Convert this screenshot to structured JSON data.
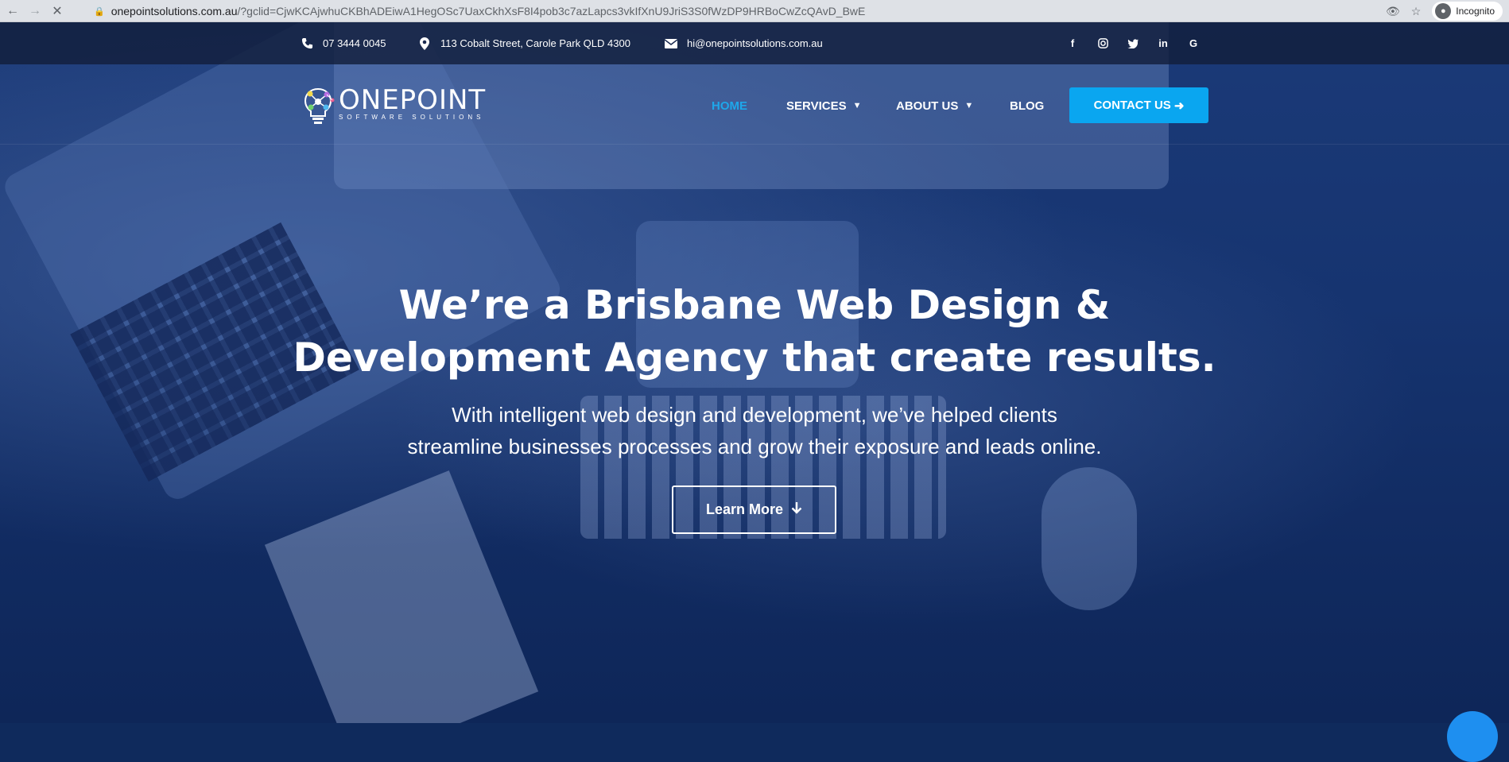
{
  "browser": {
    "url_host": "onepointsolutions.com.au",
    "url_path": "/?gclid=CjwKCAjwhuCKBhADEiwA1HegOSc7UaxCkhXsF8I4pob3c7azLapcs3vkIfXnU9JriS3S0fWzDP9HRBoCwZcQAvD_BwE",
    "incognito_label": "Incognito"
  },
  "topbar": {
    "phone": "07 3444 0045",
    "address": "113 Cobalt Street, Carole Park QLD 4300",
    "email": "hi@onepointsolutions.com.au",
    "social": [
      "facebook-icon",
      "instagram-icon",
      "twitter-icon",
      "linkedin-icon",
      "google-icon"
    ]
  },
  "logo": {
    "name": "ONEPOINT",
    "tagline": "SOFTWARE SOLUTIONS"
  },
  "nav": {
    "home": "HOME",
    "services": "SERVICES",
    "about": "ABOUT US",
    "blog": "BLOG",
    "contact": "CONTACT US"
  },
  "hero": {
    "headline_line1": "We’re a Brisbane Web Design &",
    "headline_line2": "Development Agency that create results.",
    "sub_line1": "With intelligent web design and development, we’ve helped clients",
    "sub_line2": "streamline businesses processes and grow their exposure and leads online.",
    "button": "Learn More"
  },
  "colors": {
    "accent": "#0aa6f0",
    "nav_active": "#1ea7ea",
    "hero_overlay": "#163470"
  }
}
